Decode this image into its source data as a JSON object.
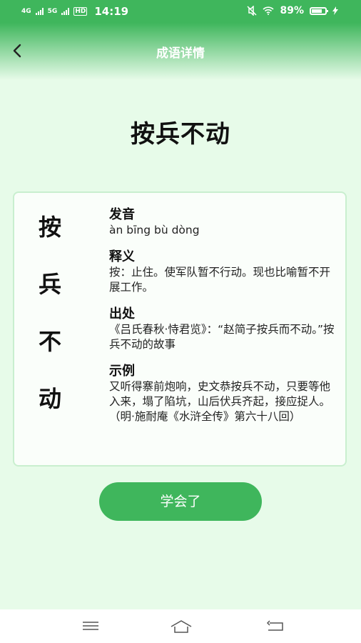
{
  "status": {
    "net1": "4G",
    "net2": "5G",
    "hd": "HD",
    "time": "14:19",
    "battery": "89%",
    "battery_level": 0.89
  },
  "header": {
    "title": "成语详情"
  },
  "idiom": {
    "title": "按兵不动",
    "chars": [
      "按",
      "兵",
      "不",
      "动"
    ]
  },
  "sections": [
    {
      "label": "发音",
      "text": "àn bīng bù dòng"
    },
    {
      "label": "释义",
      "text": "按：止住。使军队暂不行动。现也比喻暂不开展工作。"
    },
    {
      "label": "出处",
      "text": "《吕氏春秋·恃君览》：“赵简子按兵而不动。”按兵不动的故事"
    },
    {
      "label": "示例",
      "text": "又听得寨前炮响，史文恭按兵不动，只要等他入来，塌了陷坑，山后伏兵齐起，接应捉人。（明·施耐庵《水浒全传》第六十八回）"
    }
  ],
  "button": {
    "label": "学会了"
  },
  "icons": {
    "back": "chevron-left-icon",
    "mute": "mute-icon",
    "wifi": "wifi-icon",
    "charging": "bolt-icon",
    "nav_menu": "menu-icon",
    "nav_home": "home-icon",
    "nav_back": "return-icon"
  },
  "colors": {
    "accent": "#3fb65c",
    "background": "#e7fbe9",
    "card_border": "#c9efcf"
  }
}
